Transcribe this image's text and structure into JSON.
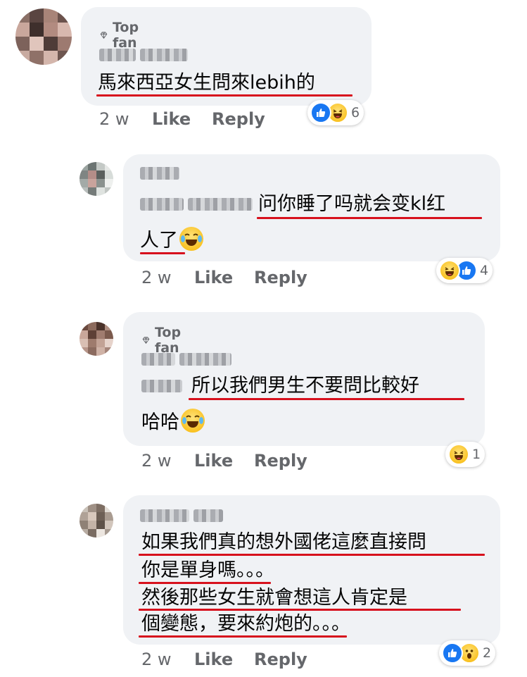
{
  "comments": [
    {
      "badge": "Top fan",
      "lines": [
        "馬來西亞女生問來lebih的"
      ],
      "age": "2 w",
      "like": "Like",
      "reply": "Reply",
      "reactions": {
        "icons": [
          "like-icon",
          "haha-icon"
        ],
        "count": "6"
      }
    },
    {
      "badge": "",
      "lines": [
        "问你睡了吗就会变kl红",
        "人了"
      ],
      "age": "2 w",
      "like": "Like",
      "reply": "Reply",
      "reactions": {
        "icons": [
          "haha-icon",
          "like-icon"
        ],
        "count": "4"
      }
    },
    {
      "badge": "Top fan",
      "lines": [
        "所以我們男生不要問比較好",
        "哈哈"
      ],
      "age": "2 w",
      "like": "Like",
      "reply": "Reply",
      "reactions": {
        "icons": [
          "haha-icon"
        ],
        "count": "1"
      }
    },
    {
      "badge": "",
      "lines": [
        "如果我們真的想外國佬這麼直接問",
        "你是單身嗎。。。",
        "然後那些女生就會想這人肯定是",
        "個變態，要來約炮的。。。"
      ],
      "age": "2 w",
      "like": "Like",
      "reply": "Reply",
      "reactions": {
        "icons": [
          "like-icon",
          "wow-icon"
        ],
        "count": "2"
      }
    }
  ],
  "colors": {
    "bubble": "#f0f2f5",
    "underline": "#d7111d",
    "like_blue": "#1877f2",
    "secondary_text": "#65676b"
  }
}
